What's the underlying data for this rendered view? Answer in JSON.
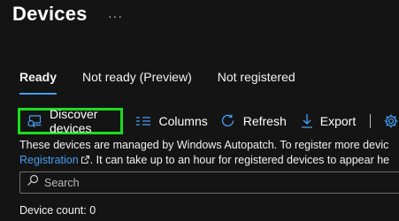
{
  "header": {
    "title": "Devices",
    "more_label": "···"
  },
  "tabs": [
    {
      "label": "Ready",
      "active": true
    },
    {
      "label": "Not ready (Preview)",
      "active": false
    },
    {
      "label": "Not registered",
      "active": false
    }
  ],
  "toolbar": {
    "discover_label": "Discover devices",
    "columns_label": "Columns",
    "refresh_label": "Refresh",
    "export_label": "Export"
  },
  "info": {
    "line1": "These devices are managed by Windows Autopatch. To register more devic",
    "link": "Registration",
    "line2_rest": ". It can take up to an hour for registered devices to appear he"
  },
  "search": {
    "placeholder": "Search"
  },
  "device_count": "Device count: 0",
  "colors": {
    "background": "#141414",
    "accent": "#479ef5",
    "highlight": "#1ddc1d"
  },
  "icons": [
    "discover-devices-icon",
    "columns-icon",
    "refresh-icon",
    "download-icon",
    "gear-icon",
    "external-link-icon",
    "search-icon"
  ]
}
